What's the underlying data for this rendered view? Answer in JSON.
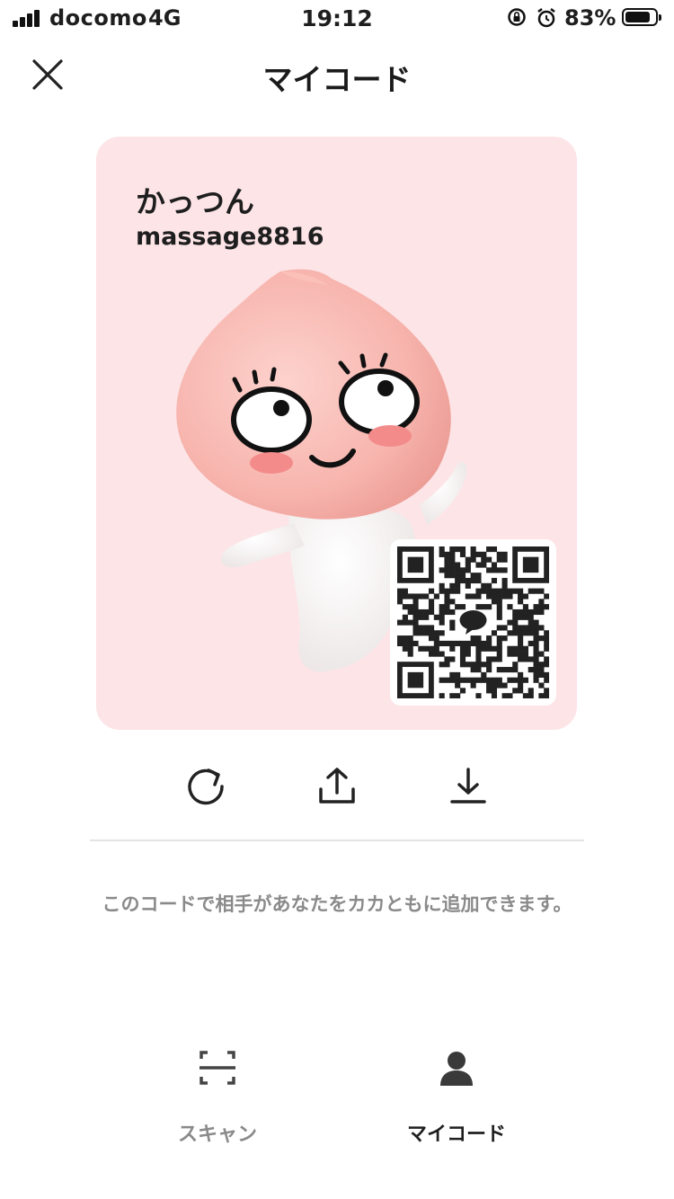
{
  "status_bar": {
    "carrier": "docomo",
    "network": "4G",
    "time": "19:12",
    "battery": "83%",
    "battery_level": 0.83
  },
  "header": {
    "title": "マイコード",
    "close_icon": "close-icon"
  },
  "card": {
    "name": "かっつん",
    "id": "massage8816",
    "background": "#fde4e7",
    "avatar": "apeach-character"
  },
  "actions": [
    "refresh-icon",
    "share-icon",
    "download-icon"
  ],
  "hint": "このコードで相手があなたをカカともに追加できます。",
  "tabs": [
    {
      "label": "スキャン",
      "icon": "scan-icon",
      "active": false
    },
    {
      "label": "マイコード",
      "icon": "person-icon",
      "active": true
    }
  ],
  "colors": {
    "active_tab": "#1e1e1e",
    "inactive_tab": "#8a8a8a",
    "card_bg": "#fde4e7"
  }
}
